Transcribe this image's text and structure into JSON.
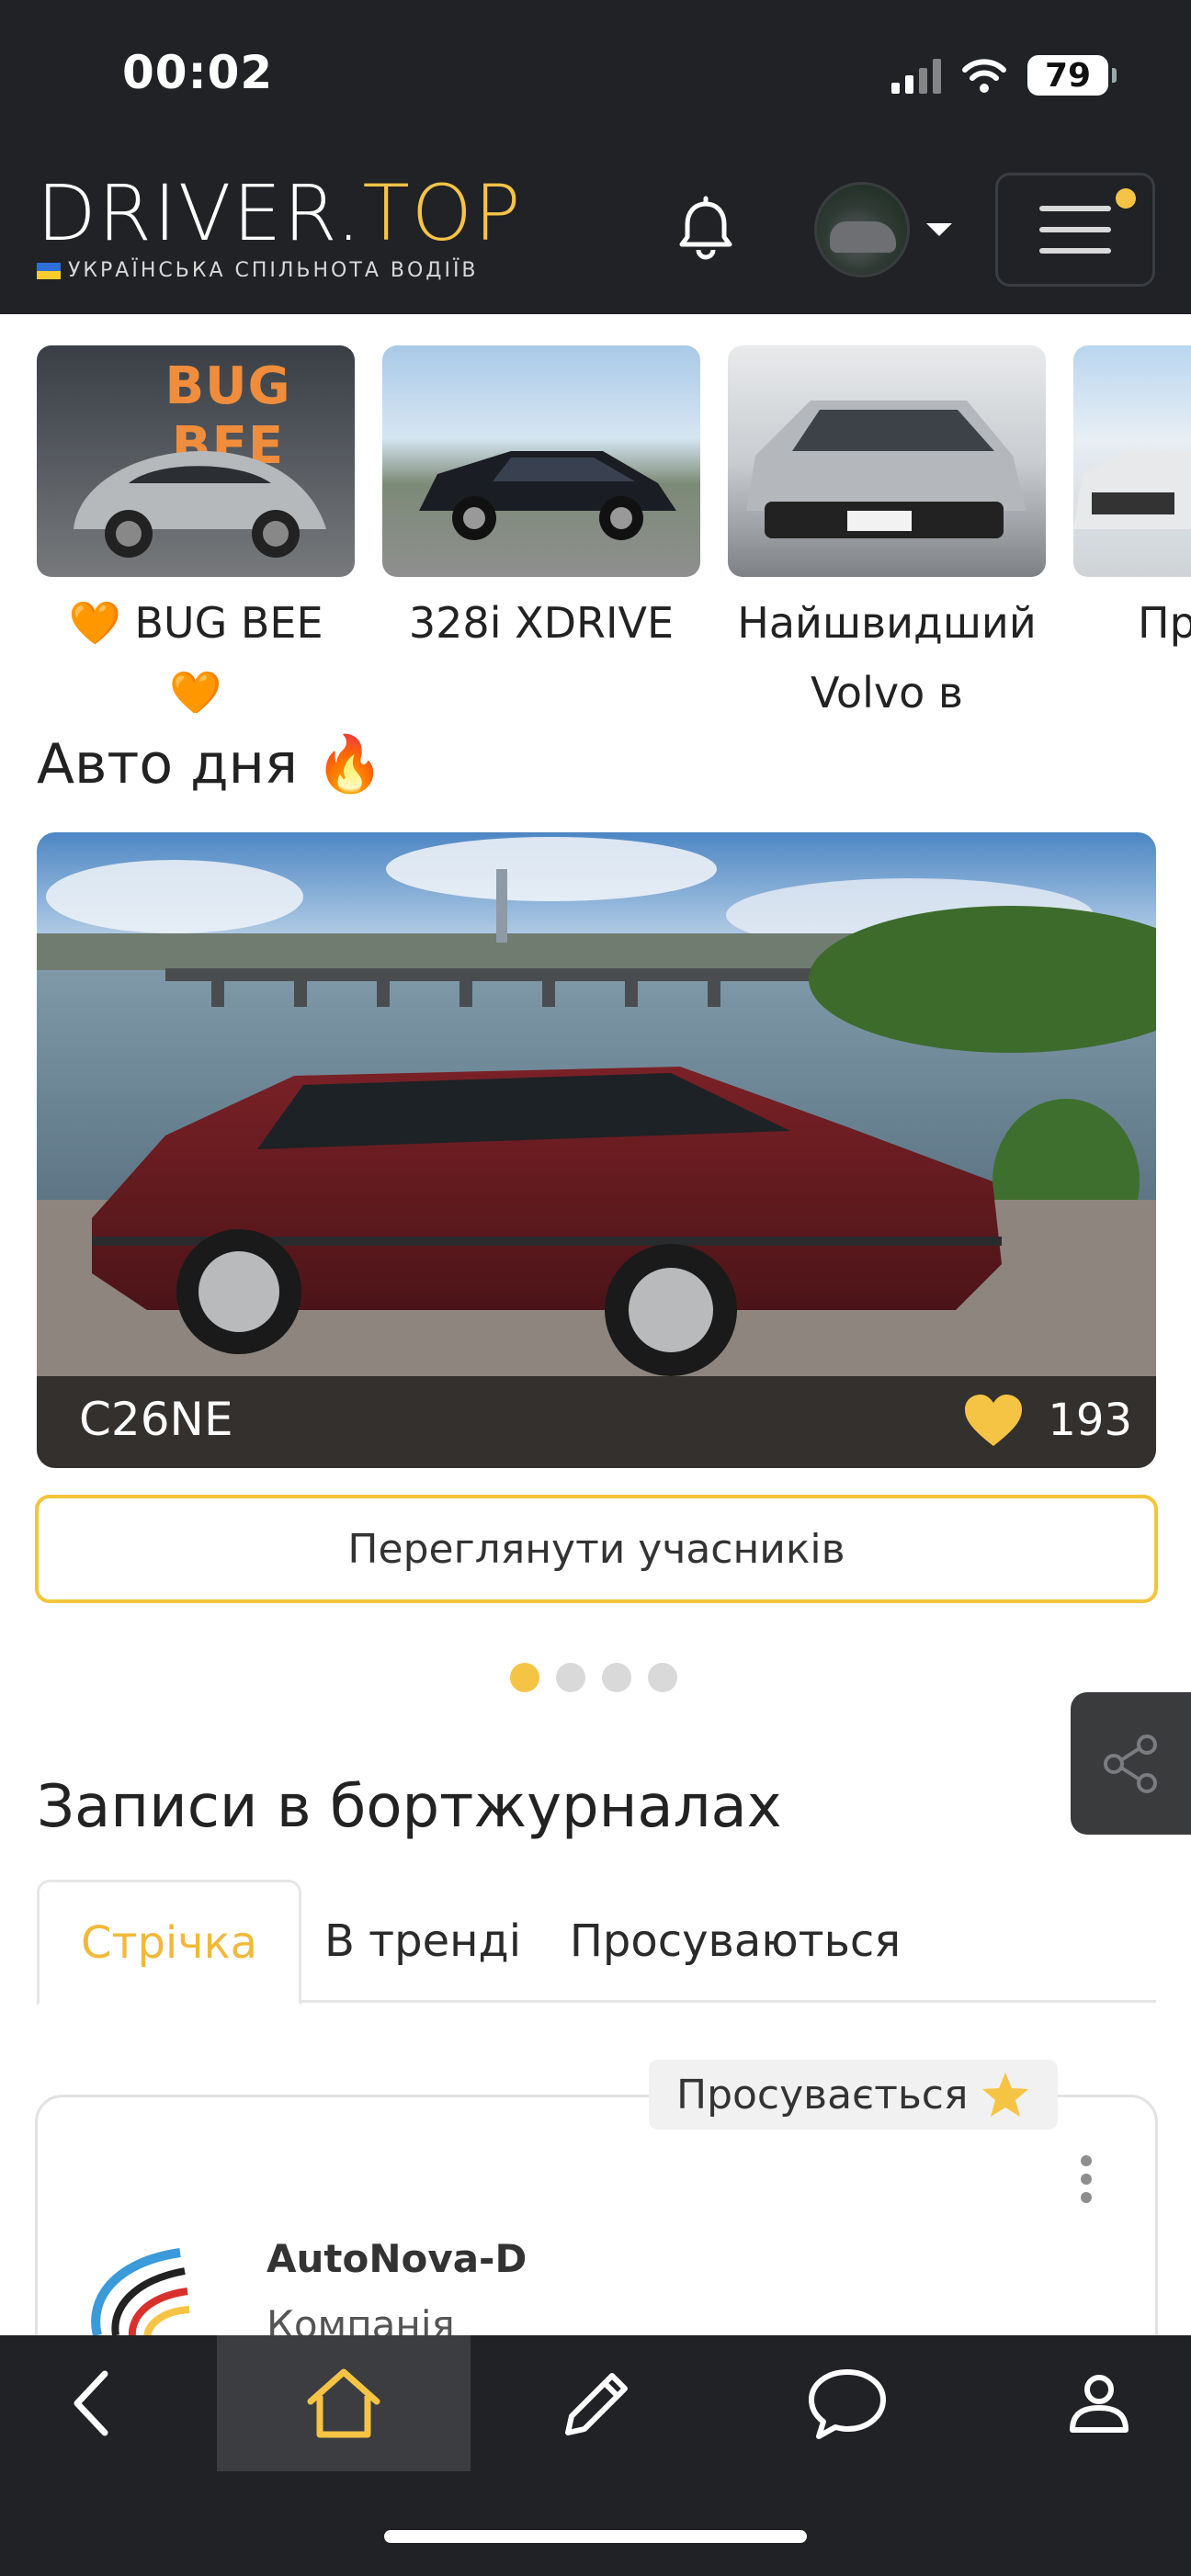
{
  "status_bar": {
    "time": "00:02",
    "battery": "79"
  },
  "header": {
    "logo_main": "DRIVER.",
    "logo_accent": "TOP",
    "logo_sub": "УКРАЇНСЬКА СПІЛЬНОТА ВОДІЇВ",
    "icons": [
      "bell-icon",
      "avatar",
      "chevron-down-icon",
      "menu-icon"
    ],
    "accent_color": "#f6c445"
  },
  "stories": [
    {
      "label": "🧡 BUG BEE 🧡",
      "badge_text": "BUG BEE"
    },
    {
      "label": "328i XDRIVE"
    },
    {
      "label": "Найшвидший Volvo в історії!"
    },
    {
      "label": "Пр гара"
    }
  ],
  "auto_of_day": {
    "title": "Авто дня 🔥",
    "car_name": "C26NE",
    "likes": "193",
    "button": "Переглянути учасників",
    "dots_total": 4,
    "dots_active": 0
  },
  "logbook": {
    "title": "Записи в бортжурналах",
    "tabs": [
      "Стрічка",
      "В тренді",
      "Просуваються"
    ],
    "active_tab": 0,
    "post": {
      "badge": "Просувається",
      "author": "AutoNova-D",
      "author_type": "Компанія"
    }
  },
  "bottom_nav": [
    "back-icon",
    "home-icon",
    "pencil-icon",
    "chat-icon",
    "profile-icon"
  ]
}
